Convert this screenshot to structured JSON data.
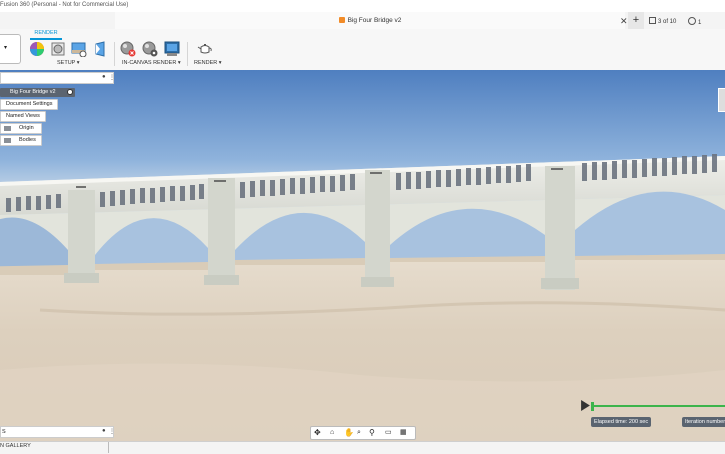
{
  "app": {
    "title": "Fusion 360 (Personal - Not for Commercial Use)",
    "document_title": "Big Four Bridge v2",
    "jobs_counter": "3 of 10",
    "notification_count": "1"
  },
  "ribbon": {
    "active_tab": "RENDER",
    "groups": {
      "setup": "SETUP ▾",
      "in_canvas_render": "IN-CANVAS RENDER ▾",
      "render": "RENDER ▾"
    }
  },
  "browser": {
    "root": "Big Four Bridge v2",
    "items": [
      "Document Settings",
      "Named Views",
      "Origin",
      "Bodies"
    ]
  },
  "comments": {
    "label": "S"
  },
  "gallery": {
    "label": "N GALLERY"
  },
  "render_status": {
    "elapsed": "Elapsed time: 200 sec",
    "iteration": "Iteration number",
    "progress": 1.0
  },
  "colors": {
    "accent": "#0696d7",
    "progress": "#3cb44b",
    "sky_top": "#6f9bd1",
    "ground": "#dcd0c0",
    "bridge": "#e6e6df"
  }
}
